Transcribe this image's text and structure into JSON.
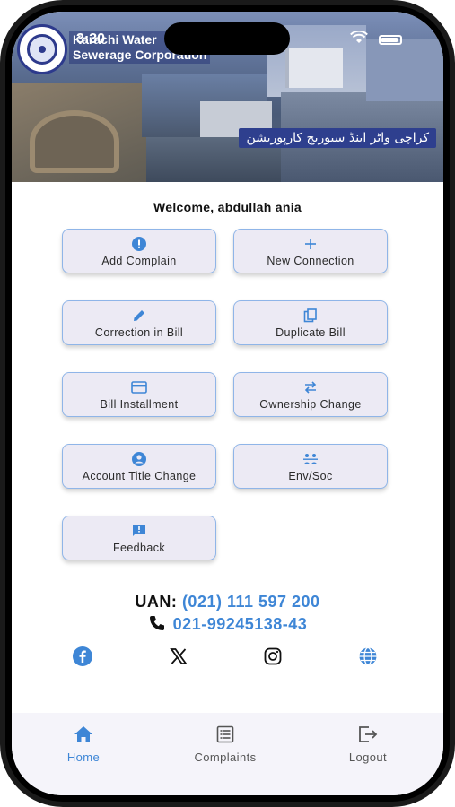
{
  "status_bar": {
    "time": "3:30"
  },
  "banner": {
    "org_name_line1": "Karachi Water",
    "org_name_line2": "Sewerage Corporation",
    "urdu_name": "کراچی واٹر اینڈ سیوریج کارپوریشن"
  },
  "welcome": "Welcome, abdullah ania",
  "services": [
    {
      "label": "Add Complain",
      "icon": "alert-circle-icon"
    },
    {
      "label": "New Connection",
      "icon": "plus-icon"
    },
    {
      "label": "Correction in Bill",
      "icon": "pencil-icon"
    },
    {
      "label": "Duplicate Bill",
      "icon": "copy-icon"
    },
    {
      "label": "Bill Installment",
      "icon": "credit-card-icon"
    },
    {
      "label": "Ownership Change",
      "icon": "swap-arrows-icon"
    },
    {
      "label": "Account Title Change",
      "icon": "account-circle-icon"
    },
    {
      "label": "Env/Soc",
      "icon": "people-icon"
    },
    {
      "label": "Feedback",
      "icon": "feedback-icon"
    }
  ],
  "contact": {
    "uan_label": "UAN:",
    "uan_number": "(021) 111 597 200",
    "phone_number": "021-99245138-43"
  },
  "social": [
    "facebook-icon",
    "x-icon",
    "instagram-icon",
    "globe-icon"
  ],
  "nav": {
    "items": [
      {
        "label": "Home",
        "active": true
      },
      {
        "label": "Complaints",
        "active": false
      },
      {
        "label": "Logout",
        "active": false
      }
    ]
  },
  "colors": {
    "accent": "#3e86d6",
    "button_bg": "#eceaf4",
    "button_border": "#8fb5e8",
    "banner_label": "#2e3f8e"
  }
}
